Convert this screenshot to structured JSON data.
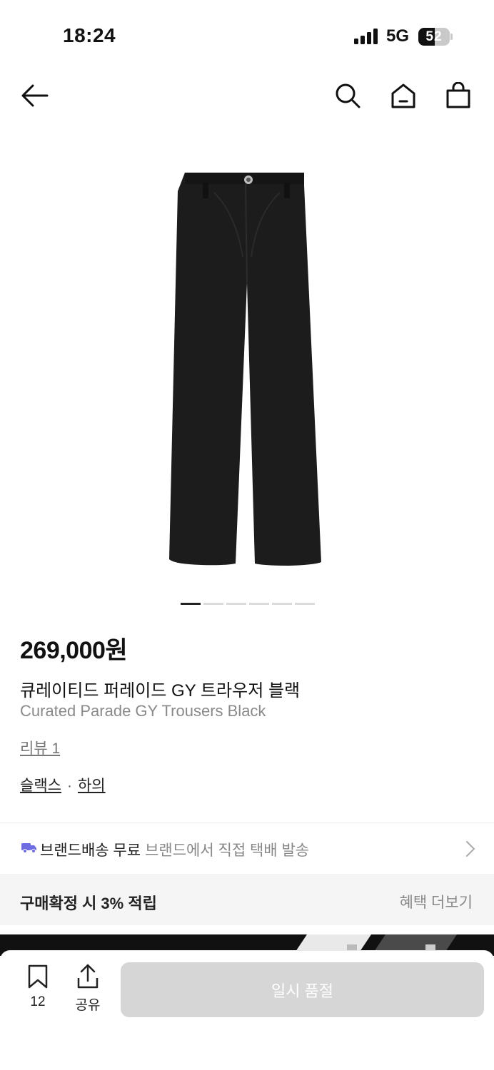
{
  "status_bar": {
    "time": "18:24",
    "network": "5G",
    "battery_level": "52",
    "battery_fraction": 0.52
  },
  "navbar": {
    "icons": [
      "back-arrow-icon",
      "search-icon",
      "home-icon",
      "shopping-bag-icon"
    ]
  },
  "gallery": {
    "image": "black trousers product photo",
    "total_pages": 6,
    "active_page": 1
  },
  "product": {
    "price": "269,000원",
    "name_ko": "큐레이티드 퍼레이드 GY 트라우저 블랙",
    "name_en": "Curated Parade GY Trousers Black",
    "review_link": "리뷰 1",
    "category_1": "슬랙스",
    "category_separator": "·",
    "category_2": "하의"
  },
  "shipping": {
    "icon": "truck-icon",
    "title": "브랜드배송 무료",
    "detail": "브랜드에서 직접 택배 발송"
  },
  "points": {
    "label": "구매확정 시 3% 적립",
    "more_link": "혜택 더보기"
  },
  "bottom_bar": {
    "bookmark_count": "12",
    "share_label": "공유",
    "buy_button_label": "일시 품절"
  },
  "colors": {
    "accent_truck": "#6f6de2",
    "disabled_button": "#d6d6d6",
    "points_bg": "#f5f5f5"
  }
}
